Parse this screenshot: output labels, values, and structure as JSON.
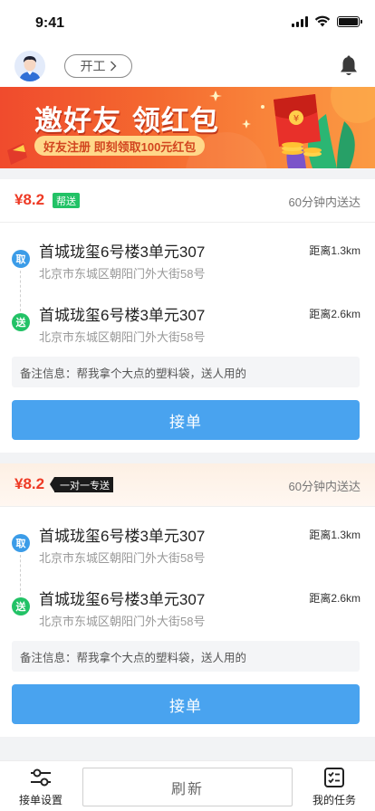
{
  "status_bar": {
    "time": "9:41"
  },
  "header": {
    "work_label": "开工",
    "avatar_icon": "avatar-icon",
    "bell_icon": "bell-icon"
  },
  "banner": {
    "title": "邀好友 领红包",
    "subtitle": "好友注册 即刻领取100元红包",
    "coin_symbol": "¥"
  },
  "orders": [
    {
      "price": "¥8.2",
      "tag": "帮送",
      "tag_color": "#22c266",
      "eta": "60分钟内送达",
      "header_bg": "#ffffff",
      "pickup": {
        "badge": "取",
        "title": "首城珑玺6号楼3单元307",
        "address": "北京市东城区朝阳门外大街58号",
        "distance": "距离1.3km"
      },
      "dropoff": {
        "badge": "送",
        "title": "首城珑玺6号楼3单元307",
        "address": "北京市东城区朝阳门外大街58号",
        "distance": "距离2.6km"
      },
      "note": "备注信息：帮我拿个大点的塑料袋，送人用的",
      "accept_label": "接单"
    },
    {
      "price": "¥8.2",
      "tag": "一对一专送",
      "tag_color": "#1a1a1a",
      "eta": "60分钟内送达",
      "header_bg": "#fdf3ea",
      "pickup": {
        "badge": "取",
        "title": "首城珑玺6号楼3单元307",
        "address": "北京市东城区朝阳门外大街58号",
        "distance": "距离1.3km"
      },
      "dropoff": {
        "badge": "送",
        "title": "首城珑玺6号楼3单元307",
        "address": "北京市东城区朝阳门外大街58号",
        "distance": "距离2.6km"
      },
      "note": "备注信息：帮我拿个大点的塑料袋，送人用的",
      "accept_label": "接单"
    }
  ],
  "tabbar": {
    "settings_label": "接单设置",
    "refresh_label": "刷新",
    "tasks_label": "我的任务"
  },
  "colors": {
    "price": "#ee3a25",
    "accept": "#49a3ef",
    "pick": "#3b9ce8",
    "drop": "#22c266",
    "banner": "#f4682f"
  }
}
